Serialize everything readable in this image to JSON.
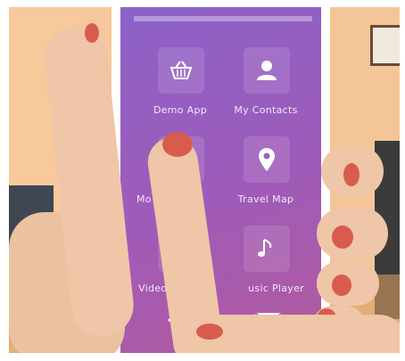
{
  "apps": [
    {
      "label": "Demo App",
      "icon": "basket-icon"
    },
    {
      "label": "My Contacts",
      "icon": "person-icon"
    },
    {
      "label": "Mo",
      "icon": "unknown-icon"
    },
    {
      "label": "Travel Map",
      "icon": "map-pin-icon"
    },
    {
      "label": "Video Play",
      "icon": "play-icon"
    },
    {
      "label": "usic Player",
      "icon": "music-note-icon"
    }
  ],
  "dock": [
    {
      "icon": "phone-handset-icon"
    },
    {
      "icon": "envelope-icon"
    }
  ],
  "colors": {
    "wall": "#f6c79a",
    "screen_top": "#8b62c8",
    "screen_bottom": "#b25a9c",
    "skin": "#efc6a7",
    "nail": "#d85c4e"
  }
}
